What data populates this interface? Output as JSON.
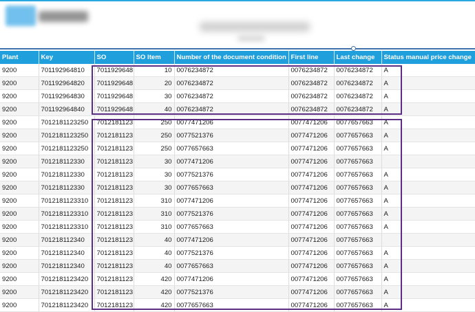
{
  "table": {
    "columns": [
      "Plant",
      "Key",
      "SO",
      "SO Item",
      "Number of the document condition",
      "First line",
      "Last change",
      "Status manual price change"
    ],
    "rows": [
      [
        "9200",
        "701192964810",
        "7011929648",
        "10",
        "0076234872",
        "0076234872",
        "0076234872",
        "A"
      ],
      [
        "9200",
        "701192964820",
        "7011929648",
        "20",
        "0076234872",
        "0076234872",
        "0076234872",
        "A"
      ],
      [
        "9200",
        "701192964830",
        "7011929648",
        "30",
        "0076234872",
        "0076234872",
        "0076234872",
        "A"
      ],
      [
        "9200",
        "701192964840",
        "7011929648",
        "40",
        "0076234872",
        "0076234872",
        "0076234872",
        "A"
      ],
      [
        "9200",
        "7012181123250",
        "7012181123",
        "250",
        "0077471206",
        "0077471206",
        "0077657663",
        "A"
      ],
      [
        "9200",
        "7012181123250",
        "7012181123",
        "250",
        "0077521376",
        "0077471206",
        "0077657663",
        "A"
      ],
      [
        "9200",
        "7012181123250",
        "7012181123",
        "250",
        "0077657663",
        "0077471206",
        "0077657663",
        "A"
      ],
      [
        "9200",
        "701218112330",
        "7012181123",
        "30",
        "0077471206",
        "0077471206",
        "0077657663",
        ""
      ],
      [
        "9200",
        "701218112330",
        "7012181123",
        "30",
        "0077521376",
        "0077471206",
        "0077657663",
        "A"
      ],
      [
        "9200",
        "701218112330",
        "7012181123",
        "30",
        "0077657663",
        "0077471206",
        "0077657663",
        "A"
      ],
      [
        "9200",
        "7012181123310",
        "7012181123",
        "310",
        "0077471206",
        "0077471206",
        "0077657663",
        "A"
      ],
      [
        "9200",
        "7012181123310",
        "7012181123",
        "310",
        "0077521376",
        "0077471206",
        "0077657663",
        "A"
      ],
      [
        "9200",
        "7012181123310",
        "7012181123",
        "310",
        "0077657663",
        "0077471206",
        "0077657663",
        "A"
      ],
      [
        "9200",
        "701218112340",
        "7012181123",
        "40",
        "0077471206",
        "0077471206",
        "0077657663",
        ""
      ],
      [
        "9200",
        "701218112340",
        "7012181123",
        "40",
        "0077521376",
        "0077471206",
        "0077657663",
        "A"
      ],
      [
        "9200",
        "701218112340",
        "7012181123",
        "40",
        "0077657663",
        "0077471206",
        "0077657663",
        "A"
      ],
      [
        "9200",
        "7012181123420",
        "7012181123",
        "420",
        "0077471206",
        "0077471206",
        "0077657663",
        "A"
      ],
      [
        "9200",
        "7012181123420",
        "7012181123",
        "420",
        "0077521376",
        "0077471206",
        "0077657663",
        "A"
      ],
      [
        "9200",
        "7012181123420",
        "7012181123",
        "420",
        "0077657663",
        "0077471206",
        "0077657663",
        "A"
      ]
    ]
  },
  "colors": {
    "header_bg": "#1f9fdc",
    "highlight_border": "#5b2d84",
    "accent_line": "#29a8e0"
  }
}
